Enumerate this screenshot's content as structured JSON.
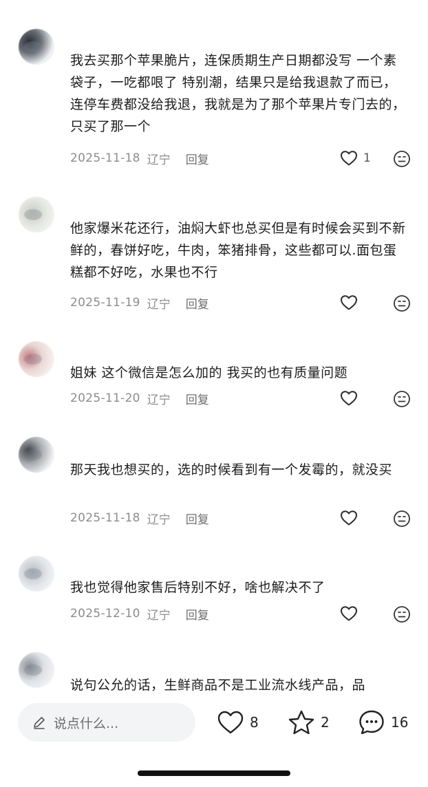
{
  "comments": [
    {
      "text": "我去买那个苹果脆片，连保质期生产日期都没写 一个素袋子，一吃都哏了 特别潮，结果只是给我退款了而已，连停车费都没给我退，我就是为了那个苹果片专门去的，只买了那一个",
      "date": "2025-11-18",
      "location": "辽宁",
      "reply_label": "回复",
      "likes": "1"
    },
    {
      "text": "他家爆米花还行，油焖大虾也总买但是有时候会买到不新鲜的，春饼好吃，牛肉，笨猪排骨，这些都可以.面包蛋糕都不好吃，水果也不行",
      "date": "2025-11-19",
      "location": "辽宁",
      "reply_label": "回复",
      "likes": ""
    },
    {
      "text": "姐妹 这个微信是怎么加的 我买的也有质量问题",
      "date": "2025-11-20",
      "location": "辽宁",
      "reply_label": "回复",
      "likes": ""
    },
    {
      "text": "那天我也想买的，选的时候看到有一个发霉的，就没买",
      "date": "2025-11-18",
      "location": "辽宁",
      "reply_label": "回复",
      "likes": ""
    },
    {
      "text": "我也觉得他家售后特别不好，啥也解决不了",
      "date": "2025-12-10",
      "location": "辽宁",
      "reply_label": "回复",
      "likes": ""
    },
    {
      "text": "说句公允的话，生鲜商品不是工业流水线产品，品",
      "date": "",
      "location": "",
      "reply_label": "",
      "likes": ""
    }
  ],
  "bottom_bar": {
    "input_placeholder": "说点什么...",
    "like_count": "8",
    "favorite_count": "2",
    "comment_count": "16"
  },
  "icons": {
    "like": "heart-icon",
    "more": "emoji-face-icon",
    "input": "pencil-icon",
    "favorite": "star-icon",
    "comment": "speech-bubble-icon"
  },
  "colors": {
    "text": "#1c1c1c",
    "meta": "#8c8c8c",
    "input_bg": "#f3f4f6",
    "icon": "#222222"
  }
}
